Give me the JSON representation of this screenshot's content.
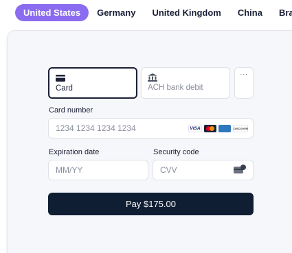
{
  "country_tabs": [
    {
      "label": "United States",
      "active": true
    },
    {
      "label": "Germany",
      "active": false
    },
    {
      "label": "United Kingdom",
      "active": false
    },
    {
      "label": "China",
      "active": false
    },
    {
      "label": "Brazil",
      "active": false
    }
  ],
  "payment_methods": [
    {
      "label": "Card",
      "icon": "credit-card-icon",
      "selected": true
    },
    {
      "label": "ACH bank debit",
      "icon": "bank-icon",
      "selected": false
    }
  ],
  "more_methods_label": "···",
  "card_number": {
    "label": "Card number",
    "placeholder": "1234 1234 1234 1234",
    "brands": [
      "visa-icon",
      "mastercard-icon",
      "amex-icon",
      "discover-icon"
    ]
  },
  "brand_text": {
    "visa": "VISA",
    "discover": "DISCOVER"
  },
  "expiration": {
    "label": "Expiration date",
    "placeholder": "MM/YY"
  },
  "security_code": {
    "label": "Security code",
    "placeholder": "CVV"
  },
  "pay_button_label": "Pay $175.00",
  "colors": {
    "accent": "#8b6cf0",
    "button": "#0f1e33",
    "panel": "#f6f7fb"
  }
}
